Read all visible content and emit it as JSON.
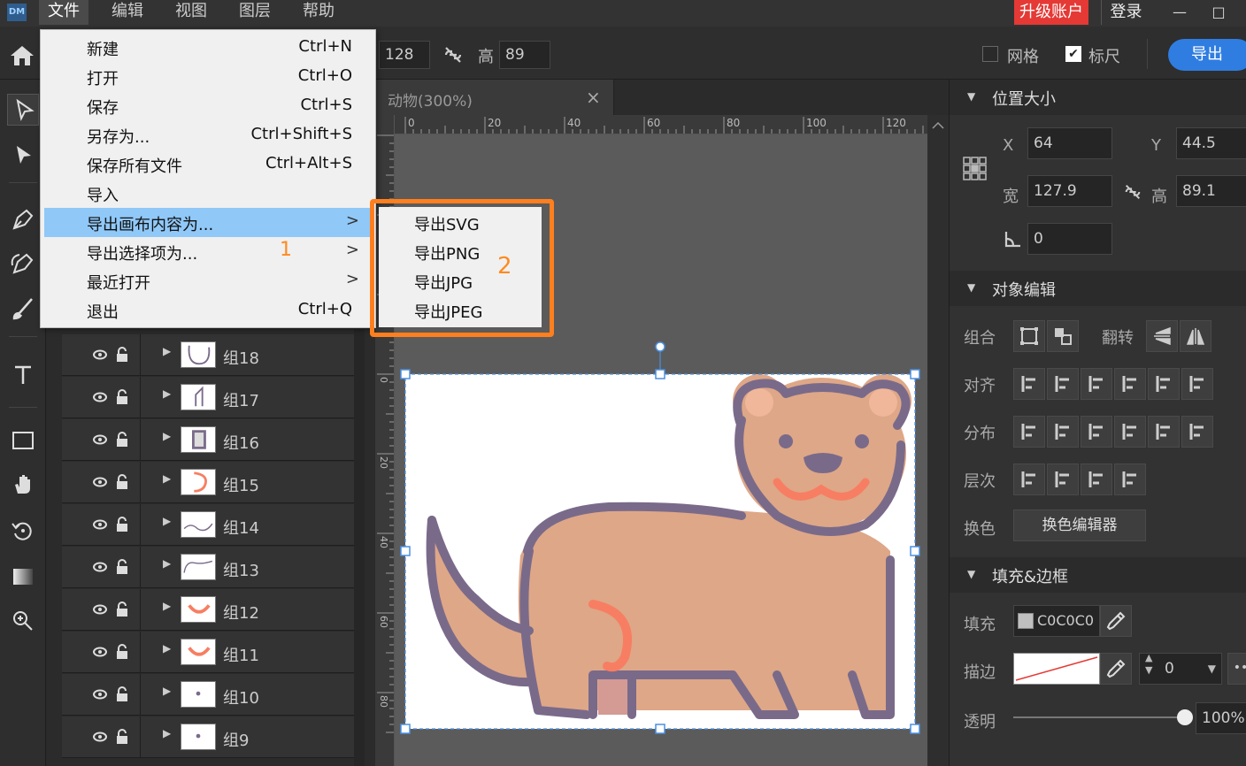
{
  "app": {
    "logo": "DM",
    "menu": [
      "文件",
      "编辑",
      "视图",
      "图层",
      "帮助"
    ],
    "upgrade": "升级账户",
    "login": "登录",
    "minimize": "—",
    "maximize": "□"
  },
  "toolbar": {
    "width_value": "128",
    "height_label": "高",
    "height_value": "89",
    "grid_label": "网格",
    "ruler_label": "标尺",
    "grid_checked": false,
    "ruler_checked": true,
    "export_label": "导出"
  },
  "file_menu": {
    "items": [
      {
        "label": "新建",
        "shortcut": "Ctrl+N"
      },
      {
        "label": "打开",
        "shortcut": "Ctrl+O"
      },
      {
        "label": "保存",
        "shortcut": "Ctrl+S"
      },
      {
        "label": "另存为...",
        "shortcut": "Ctrl+Shift+S"
      },
      {
        "label": "保存所有文件",
        "shortcut": "Ctrl+Alt+S"
      },
      {
        "label": "导入",
        "shortcut": ""
      },
      {
        "label": "导出画布内容为...",
        "shortcut": "",
        "submenu": ">",
        "highlighted": true
      },
      {
        "label": "导出选择项为...",
        "shortcut": "",
        "submenu": ">"
      },
      {
        "label": "最近打开",
        "shortcut": "",
        "submenu": ">"
      },
      {
        "label": "退出",
        "shortcut": "Ctrl+Q"
      }
    ],
    "annotation": "1"
  },
  "export_submenu": {
    "items": [
      "导出SVG",
      "导出PNG",
      "导出JPG",
      "导出JPEG"
    ],
    "annotation": "2"
  },
  "document": {
    "tab_title": "动物(300%)",
    "close": "×",
    "hruler_ticks": [
      "0",
      "20",
      "40",
      "60",
      "80",
      "100",
      "120"
    ],
    "vruler_ticks": [
      "0",
      "20",
      "40",
      "60",
      "80"
    ]
  },
  "layers": [
    {
      "name": "组18",
      "thumb": "outline-curve"
    },
    {
      "name": "组17",
      "thumb": "leg"
    },
    {
      "name": "组16",
      "thumb": "rect"
    },
    {
      "name": "组15",
      "thumb": "arc-orange"
    },
    {
      "name": "组14",
      "thumb": "body-line"
    },
    {
      "name": "组13",
      "thumb": "back-line"
    },
    {
      "name": "组12",
      "thumb": "smile-orange"
    },
    {
      "name": "组11",
      "thumb": "smile-orange"
    },
    {
      "name": "组10",
      "thumb": "dot"
    },
    {
      "name": "组9",
      "thumb": "dot"
    }
  ],
  "properties": {
    "position_size": {
      "title": "位置大小",
      "x_label": "X",
      "x": "64",
      "y_label": "Y",
      "y": "44.5",
      "w_label": "宽",
      "w": "127.9",
      "h_label": "高",
      "h": "89.1",
      "angle": "0"
    },
    "object_edit": {
      "title": "对象编辑",
      "group_label": "组合",
      "flip_label": "翻转",
      "align_label": "对齐",
      "distribute_label": "分布",
      "layer_label": "层次",
      "recolor_label": "换色",
      "recolor_button": "换色编辑器"
    },
    "fill_stroke": {
      "title": "填充&边框",
      "fill_label": "填充",
      "fill_value": "C0C0C0",
      "stroke_label": "描边",
      "stroke_width": "0",
      "opacity_label": "透明",
      "opacity_value": "100%",
      "opacity": 1.0
    }
  },
  "colors": {
    "accent_blue": "#2f7de1",
    "upgrade_red": "#e53935",
    "annotation_orange": "#ff7f1e",
    "menu_highlight": "#90c8f8",
    "animal_body": "#dea787",
    "animal_outline": "#7a6a8a",
    "animal_accent": "#f77e62",
    "animal_leg_pink": "#d49a94"
  }
}
